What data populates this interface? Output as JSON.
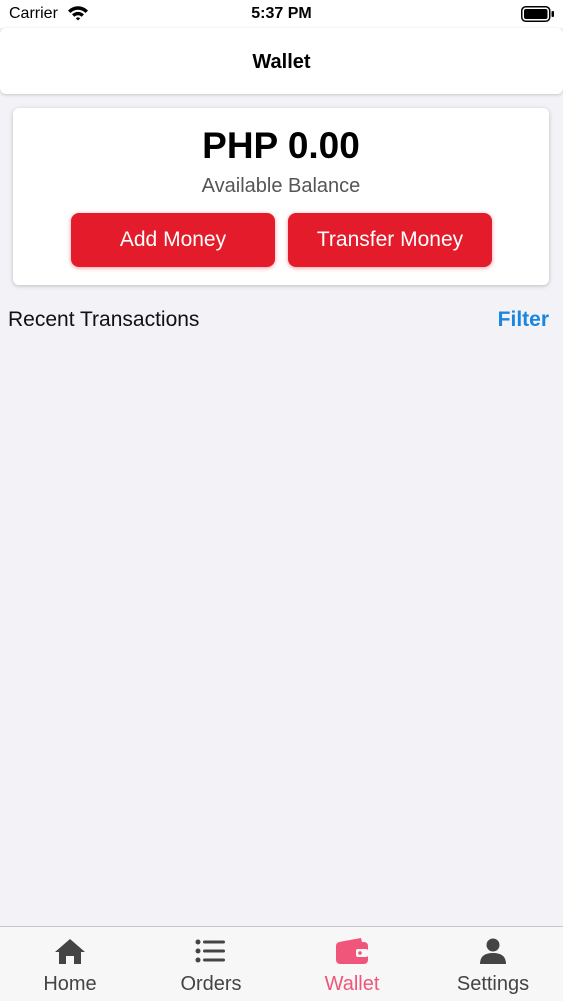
{
  "status_bar": {
    "carrier": "Carrier",
    "time": "5:37 PM"
  },
  "header": {
    "title": "Wallet"
  },
  "wallet": {
    "balance": "PHP 0.00",
    "balance_caption": "Available Balance",
    "add_money_label": "Add Money",
    "transfer_money_label": "Transfer Money"
  },
  "transactions": {
    "title": "Recent Transactions",
    "filter_label": "Filter"
  },
  "tab_bar": {
    "tabs": [
      {
        "label": "Home",
        "icon": "home-icon"
      },
      {
        "label": "Orders",
        "icon": "list-icon"
      },
      {
        "label": "Wallet",
        "icon": "wallet-icon",
        "active": true
      },
      {
        "label": "Settings",
        "icon": "person-icon"
      }
    ]
  },
  "colors": {
    "accent_red": "#e31b2a",
    "link_blue": "#1a86e0",
    "active_tab": "#f0557a",
    "background": "#f2f2f7"
  }
}
